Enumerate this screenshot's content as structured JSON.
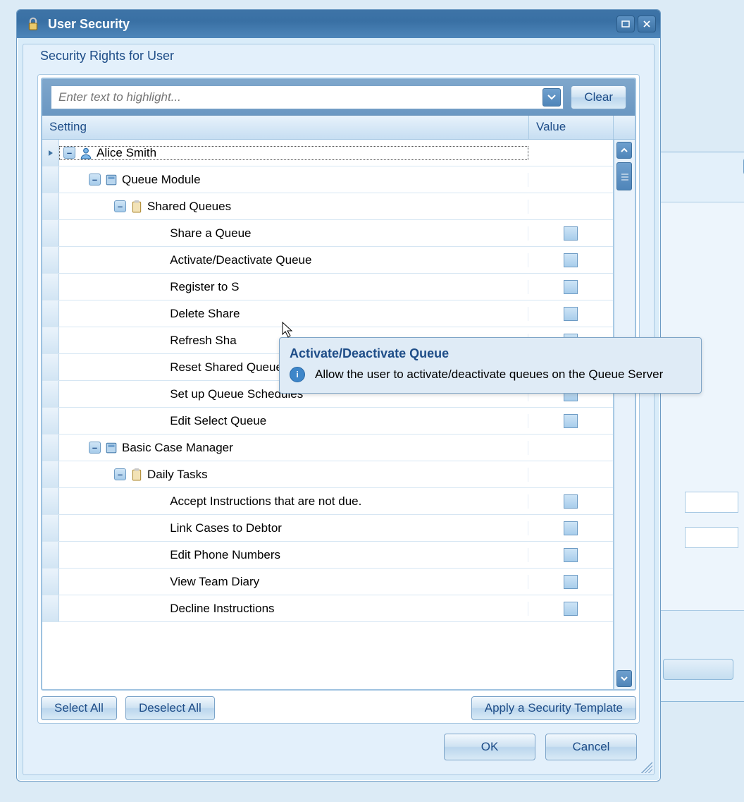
{
  "window": {
    "title": "User Security",
    "group_title": "Security Rights for User"
  },
  "search": {
    "placeholder": "Enter text to highlight...",
    "value": "",
    "clear_label": "Clear"
  },
  "columns": {
    "setting": "Setting",
    "value": "Value"
  },
  "tree": {
    "user": "Alice Smith",
    "nodes": [
      {
        "label": "Queue Module",
        "groups": [
          {
            "label": "Shared Queues",
            "items": [
              {
                "label": "Share a Queue",
                "checked": false
              },
              {
                "label": "Activate/Deactivate Queue",
                "checked": false
              },
              {
                "label": "Register to Shared Queue",
                "checked": false
              },
              {
                "label": "Delete Shared Queue",
                "checked": false
              },
              {
                "label": "Refresh Shared Queue",
                "checked": false
              },
              {
                "label": "Reset Shared Queue History",
                "checked": false
              },
              {
                "label": "Set up Queue Schedules",
                "checked": false
              },
              {
                "label": "Edit Select Queue",
                "checked": false
              }
            ]
          }
        ]
      },
      {
        "label": "Basic Case Manager",
        "groups": [
          {
            "label": "Daily Tasks",
            "items": [
              {
                "label": "Accept Instructions that are not due.",
                "checked": false
              },
              {
                "label": "Link Cases to Debtor",
                "checked": false
              },
              {
                "label": "Edit Phone Numbers",
                "checked": false
              },
              {
                "label": "View Team Diary",
                "checked": false
              },
              {
                "label": "Decline Instructions",
                "checked": false
              }
            ]
          }
        ]
      }
    ]
  },
  "tooltip": {
    "title": "Activate/Deactivate Queue",
    "body": "Allow the user to activate/deactivate queues on the Queue Server"
  },
  "buttons": {
    "select_all": "Select All",
    "deselect_all": "Deselect All",
    "apply_template": "Apply a Security Template",
    "ok": "OK",
    "cancel": "Cancel"
  }
}
